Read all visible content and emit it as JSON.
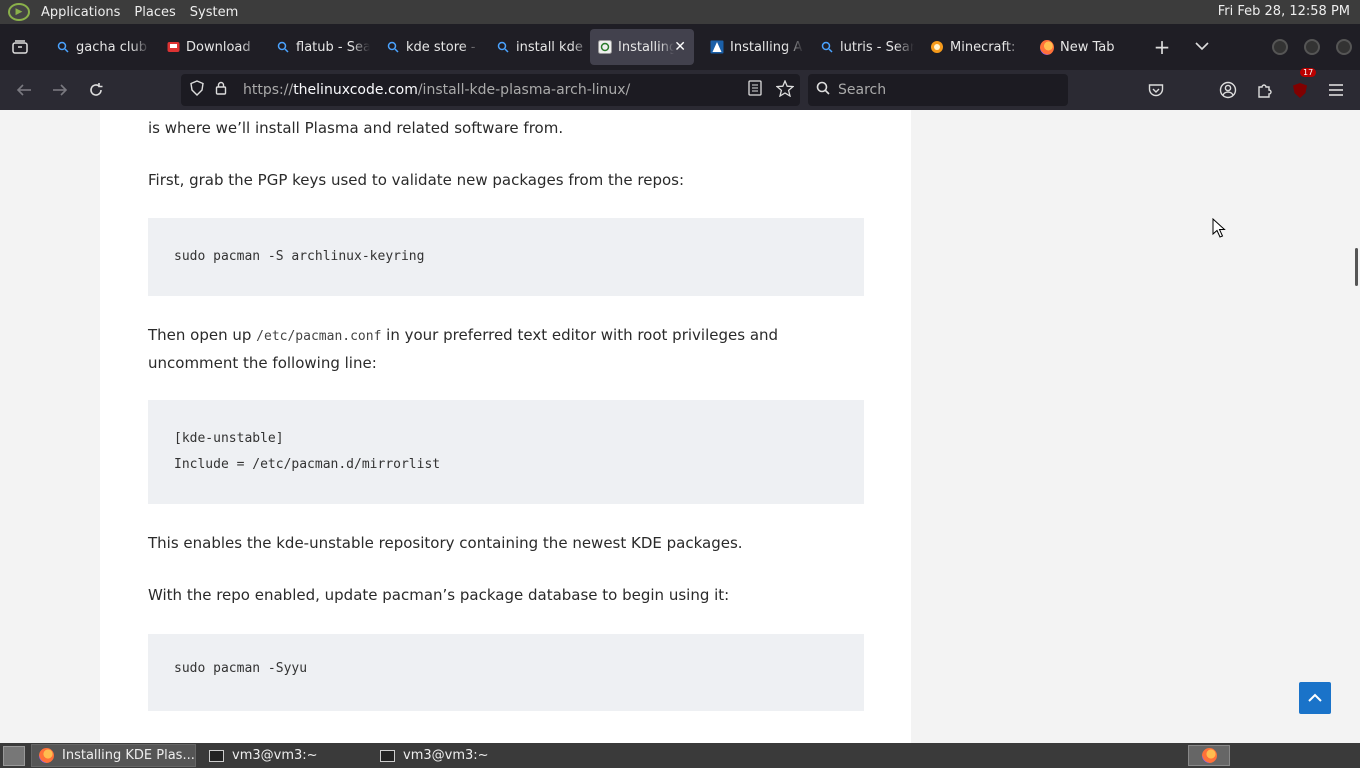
{
  "system_panel": {
    "menus": [
      "Applications",
      "Places",
      "System"
    ],
    "clock": "Fri Feb 28, 12:58 PM"
  },
  "tabs": [
    {
      "label": "gacha club",
      "icon": "search-icon"
    },
    {
      "label": "Download",
      "icon": "download-site-icon"
    },
    {
      "label": "flatub - Sea",
      "icon": "search-icon"
    },
    {
      "label": "kde store -",
      "icon": "search-icon"
    },
    {
      "label": "install kde",
      "icon": "search-icon"
    },
    {
      "label": "Installing",
      "icon": "thelinuxcode-icon",
      "active": true
    },
    {
      "label": "Installing A",
      "icon": "arch-icon"
    },
    {
      "label": "lutris - Sear",
      "icon": "search-icon"
    },
    {
      "label": "Minecraft:",
      "icon": "minecraft-site-icon"
    },
    {
      "label": "New Tab",
      "icon": "firefox-icon"
    }
  ],
  "navbar": {
    "url_prefix": "https://",
    "url_domain": "thelinuxcode.com",
    "url_path": "/install-kde-plasma-arch-linux/",
    "search_placeholder": "Search",
    "extension_badge": "17"
  },
  "article": {
    "p1": "is where we’ll install Plasma and related software from.",
    "p2": "First, grab the PGP keys used to validate new packages from the repos:",
    "code1": [
      "sudo pacman -S archlinux-keyring"
    ],
    "p3_before": "Then open up ",
    "p3_code": "/etc/pacman.conf",
    "p3_after": " in your preferred text editor with root privileges and uncomment the following line:",
    "code2": [
      "[kde-unstable]",
      "Include = /etc/pacman.d/mirrorlist"
    ],
    "p4": "This enables the kde-unstable repository containing the newest KDE packages.",
    "p5": "With the repo enabled, update pacman’s package database to begin using it:",
    "code3": [
      "sudo pacman -Syyu"
    ]
  },
  "taskbar": {
    "tasks": [
      {
        "label": "Installing KDE Plas...",
        "icon": "firefox-icon",
        "active": true
      },
      {
        "label": "vm3@vm3:~",
        "icon": "terminal-icon"
      },
      {
        "label": "vm3@vm3:~",
        "icon": "terminal-icon"
      }
    ]
  }
}
